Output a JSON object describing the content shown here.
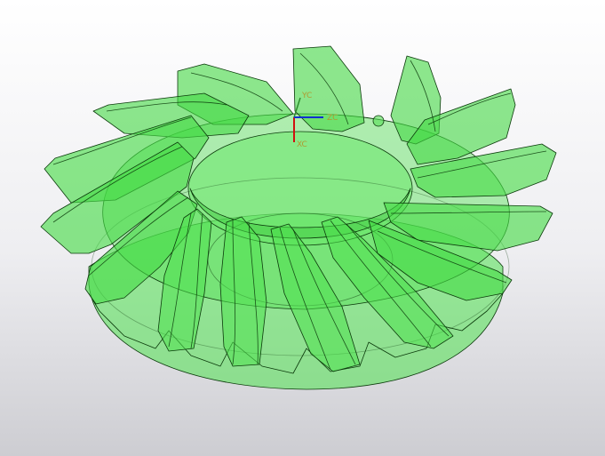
{
  "viewport": {
    "background_top": "#ffffff",
    "background_bottom": "#cdcdd2"
  },
  "model": {
    "type": "spiral-bevel-gear",
    "teeth_visible": 15,
    "fill_color": "#3fdc3f",
    "edge_color": "#0b3a0b",
    "opacity": 0.55
  },
  "wcs": {
    "x_label": "XC",
    "y_label": "YC",
    "z_label": "ZC",
    "x_color": "#d01010",
    "y_color": "#2a8a2a",
    "z_color": "#1030d0"
  }
}
